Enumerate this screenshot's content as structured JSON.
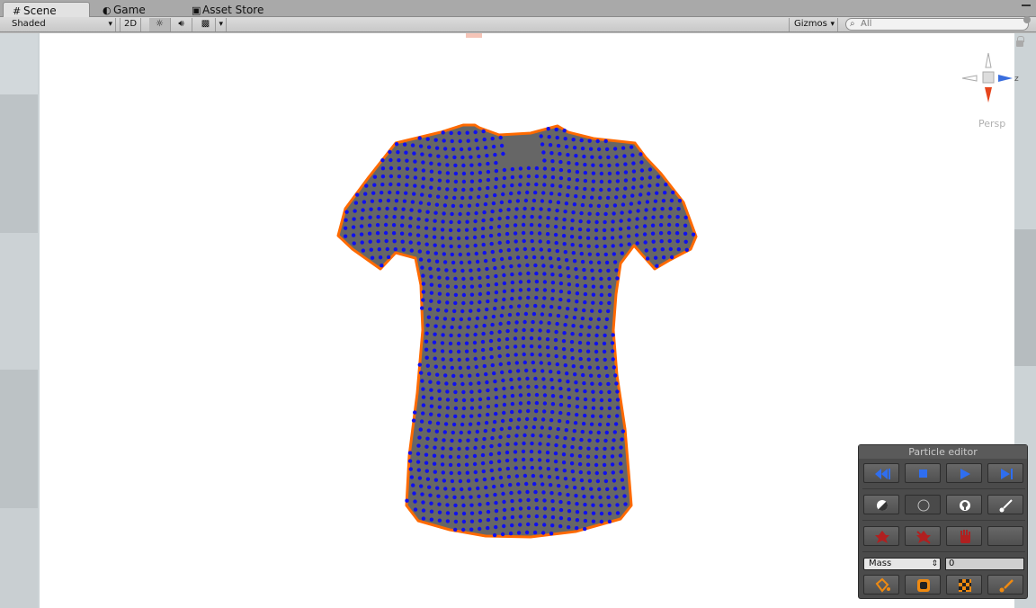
{
  "tabs": [
    {
      "label": "Scene",
      "icon": "grid-icon",
      "active": true
    },
    {
      "label": "Game",
      "icon": "pacman-icon",
      "active": false
    },
    {
      "label": "Asset Store",
      "icon": "store-icon",
      "active": false
    }
  ],
  "toolbar": {
    "render_mode": "Shaded",
    "mode_2d": "2D",
    "gizmos_label": "Gizmos",
    "search_placeholder": "All"
  },
  "scene": {
    "view_label": "Persp",
    "gizmo_axis_label": "z",
    "colors": {
      "background": "#ffffff",
      "cloth": "#666666",
      "outline": "#ff6a00",
      "particles": "#1010ee"
    }
  },
  "particle_editor": {
    "title": "Particle editor",
    "playback_buttons": [
      "rewind-icon",
      "stop-icon",
      "play-icon",
      "step-forward-icon"
    ],
    "selection_buttons": [
      "select-all-icon",
      "circle-select-icon",
      "pin-icon",
      "brush-icon"
    ],
    "action_buttons": [
      "fix-icon",
      "unfix-icon",
      "hand-icon",
      "empty"
    ],
    "property_label": "Mass",
    "property_value": "0",
    "paint_buttons": [
      "bucket-icon",
      "smooth-icon",
      "checker-icon",
      "paint-brush-icon"
    ]
  }
}
